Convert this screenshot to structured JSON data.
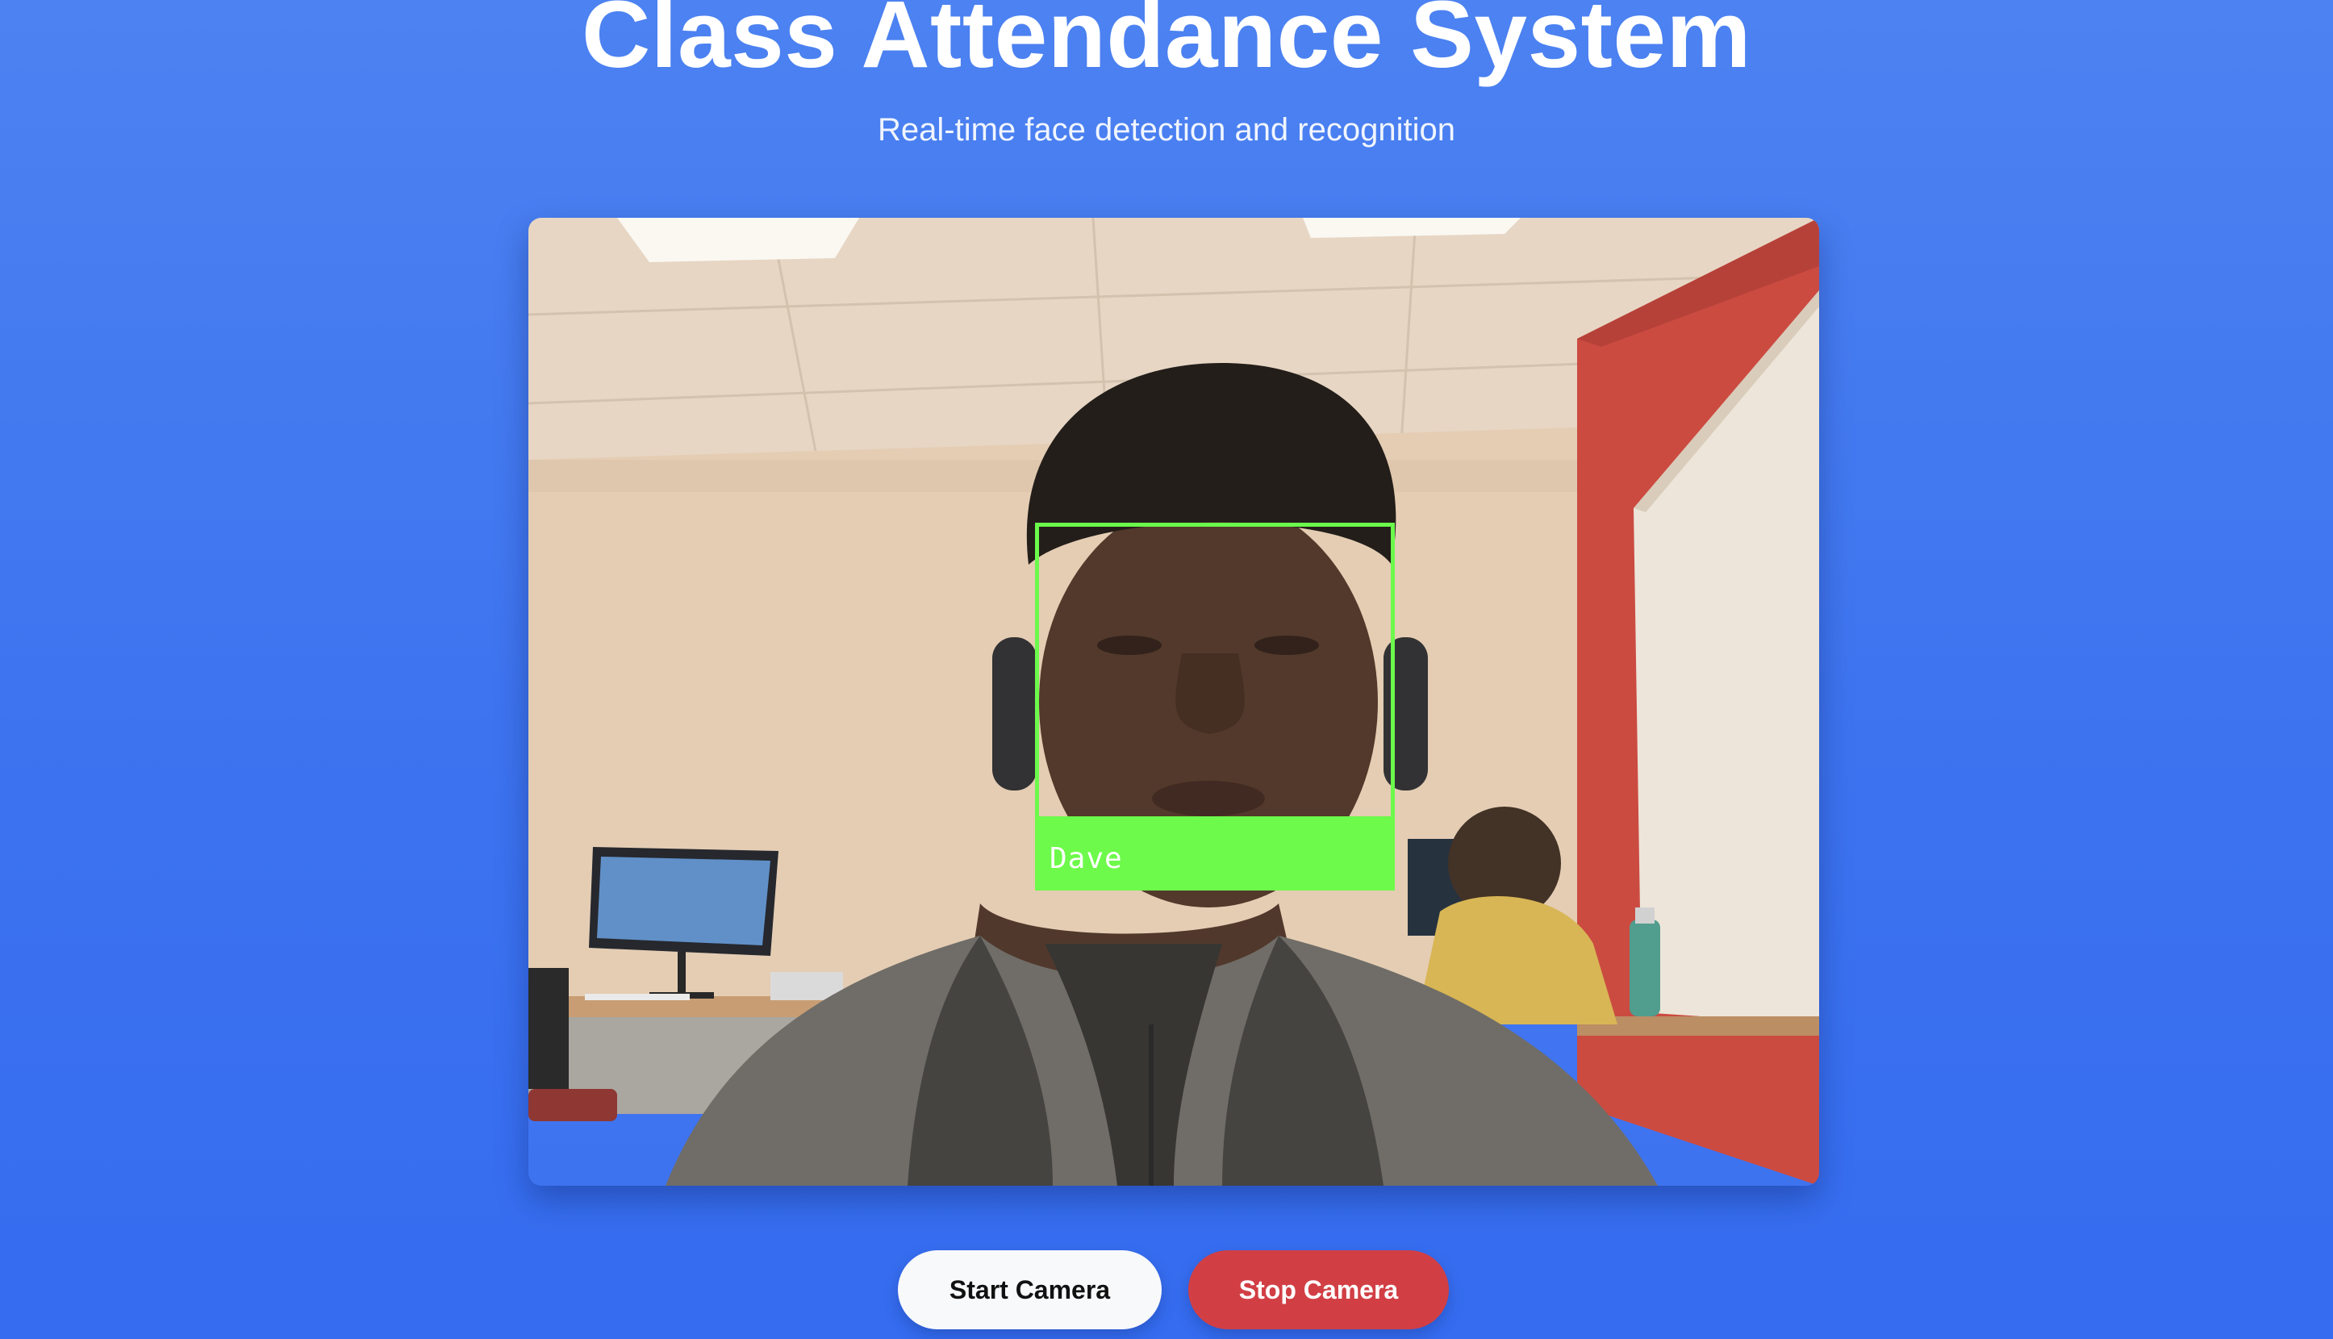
{
  "header": {
    "title": "Class Attendance System",
    "subtitle": "Real-time face detection and recognition"
  },
  "video": {
    "detection_label": "Dave",
    "box_color": "#6bfa4b"
  },
  "controls": {
    "start_label": "Start Camera",
    "stop_label": "Stop Camera"
  },
  "colors": {
    "background": "#3f74ef",
    "stop_button": "#d13f45",
    "start_button": "#f8f9fb"
  }
}
